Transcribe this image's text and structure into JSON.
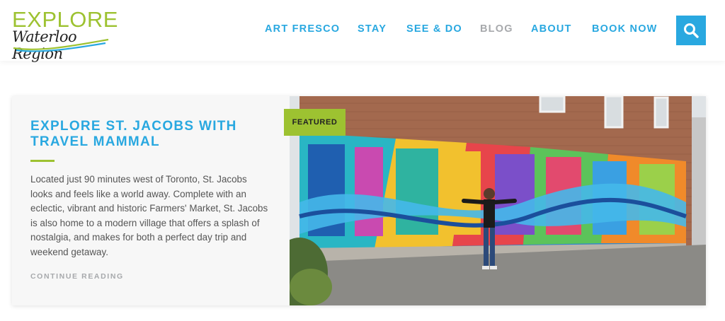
{
  "brand": {
    "logo_top": "EXPLORE",
    "logo_script": "Waterloo Region",
    "colors": {
      "accent_blue": "#29a8e0",
      "accent_green": "#9dc231",
      "muted_gray": "#a7a9ac"
    }
  },
  "nav": {
    "items": [
      {
        "label": "ART FRESCO"
      },
      {
        "label": "STAY"
      },
      {
        "label": "SEE & DO"
      },
      {
        "label": "BLOG"
      },
      {
        "label": "ABOUT"
      },
      {
        "label": "BOOK NOW"
      }
    ],
    "search_icon": "search-icon"
  },
  "article": {
    "badge": "FEATURED",
    "title": "EXPLORE ST. JACOBS WITH TRAVEL MAMMAL",
    "excerpt": "Located just 90 minutes west of Toronto, St. Jacobs looks and feels like a world away. Complete with an eclectic, vibrant and historic Farmers' Market, St. Jacobs is also home to a modern village that offers a splash of nostalgia, and makes for both a perfect day trip and weekend getaway.",
    "cta": "CONTINUE READING"
  }
}
